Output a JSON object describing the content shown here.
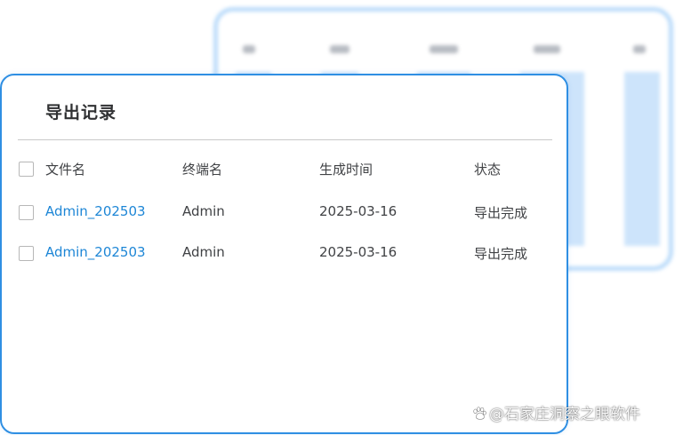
{
  "dialog": {
    "title": "导出记录"
  },
  "table": {
    "columns": [
      "文件名",
      "终端名",
      "生成时间",
      "状态"
    ],
    "rows": [
      {
        "file": "Admin_202503",
        "terminal": "Admin",
        "time": "2025-03-16",
        "status": "导出完成"
      },
      {
        "file": "Admin_202503",
        "terminal": "Admin",
        "time": "2025-03-16",
        "status": "导出完成"
      }
    ]
  },
  "watermark": {
    "text": "@石家庄洞察之眼软件"
  },
  "colors": {
    "accent": "#2f8fe3",
    "link": "#1d86d6",
    "background_card_border": "#bcdcfa"
  }
}
